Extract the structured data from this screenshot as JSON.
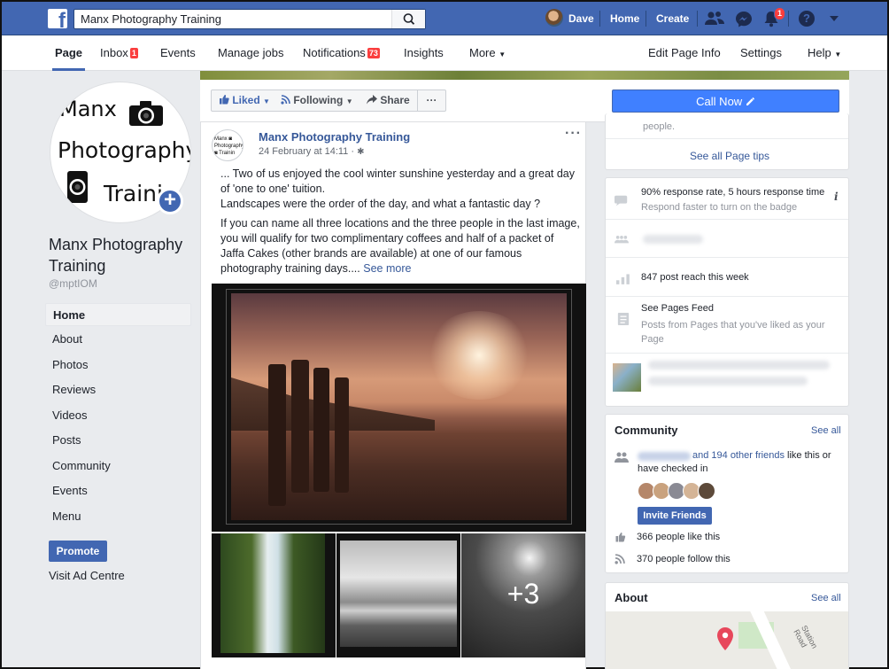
{
  "topbar": {
    "search_value": "Manx Photography Training",
    "user_name": "Dave",
    "home_label": "Home",
    "create_label": "Create",
    "notifications_badge": "1",
    "brand_color": "#4267b2"
  },
  "pagenav": {
    "page": "Page",
    "inbox": "Inbox",
    "inbox_badge": "1",
    "events": "Events",
    "manage_jobs": "Manage jobs",
    "notifications": "Notifications",
    "notifications_badge": "73",
    "insights": "Insights",
    "more": "More",
    "edit_page_info": "Edit Page Info",
    "settings": "Settings",
    "help": "Help"
  },
  "profile": {
    "logo_line1": "Manx",
    "logo_line2": "Photography",
    "logo_line3": "Traini",
    "name": "Manx Photography Training",
    "handle": "@mptIOM"
  },
  "left_nav": {
    "items": [
      "Home",
      "About",
      "Photos",
      "Reviews",
      "Videos",
      "Posts",
      "Community",
      "Events",
      "Menu"
    ],
    "promote": "Promote",
    "ad_centre": "Visit Ad Centre"
  },
  "actions": {
    "liked": "Liked",
    "following": "Following",
    "share": "Share",
    "more": "···",
    "call_now": "Call Now"
  },
  "post": {
    "author": "Manx Photography Training",
    "date": "24 February at 14:11",
    "p1_line1": "... Two of us enjoyed the cool winter sunshine yesterday and a great day",
    "p1_line2": "of 'one to one' tuition.",
    "p1_line3": "Landscapes were the order of the day, and what a fantastic day ?",
    "p2_line1": "If you can name all three locations and the three people in the last image,",
    "p2_line2": "you will qualify for two complimentary coffees and half of a packet of",
    "p2_line3": "Jaffa Cakes (other brands are available) at one of our famous",
    "p2_line4": "photography training days....",
    "see_more": "See more",
    "more_photos": "+3"
  },
  "right": {
    "tips_text": "people.",
    "see_all_tips": "See all Page tips",
    "response_rate": "90% response rate, 5 hours response time",
    "response_hint": "Respond faster to turn on the badge",
    "post_reach": "847 post reach this week",
    "pages_feed_title": "See Pages Feed",
    "pages_feed_desc_1": "Posts from Pages that you've liked as your",
    "pages_feed_desc_2": "Page",
    "community_title": "Community",
    "community_see_all": "See all",
    "friends_link": "and 194 other friends",
    "friends_suffix": "like this or",
    "friends_line2": "have checked in",
    "invite_friends": "Invite Friends",
    "likes": "366 people like this",
    "follows": "370 people follow this",
    "about_title": "About",
    "about_see_all": "See all",
    "map_road": "Station Road"
  }
}
